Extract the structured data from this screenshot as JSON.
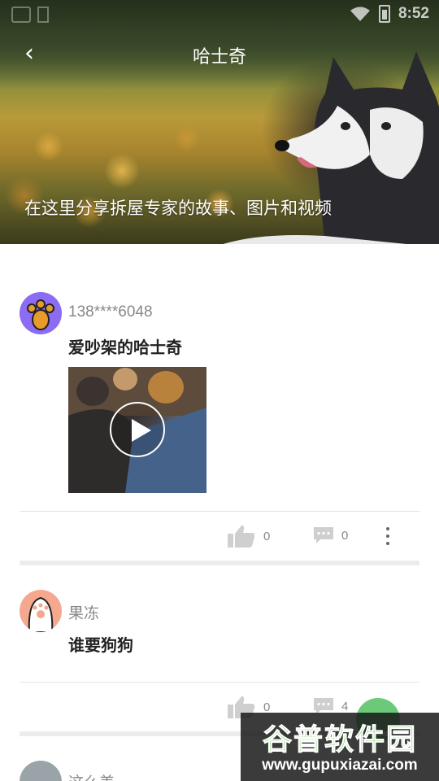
{
  "status_bar": {
    "time": "8:52"
  },
  "header": {
    "back_icon": "‹",
    "title": "哈士奇",
    "caption": "在这里分享拆屋专家的故事、图片和视频"
  },
  "posts": [
    {
      "username": "138****6048",
      "text": "爱吵架的哈士奇",
      "has_video": true,
      "likes": "0",
      "comments": "0"
    },
    {
      "username": "果冻",
      "text": "谁要狗狗",
      "likes": "0",
      "comments": "4"
    },
    {
      "username": "这么美"
    }
  ],
  "watermark": {
    "title": "谷普软件园",
    "url": "www.gupuxiazai.com"
  },
  "colors": {
    "fab": "#6cc97a",
    "avatar1_bg": "#8c6cf2",
    "avatar2_bg": "#f6a88f"
  }
}
